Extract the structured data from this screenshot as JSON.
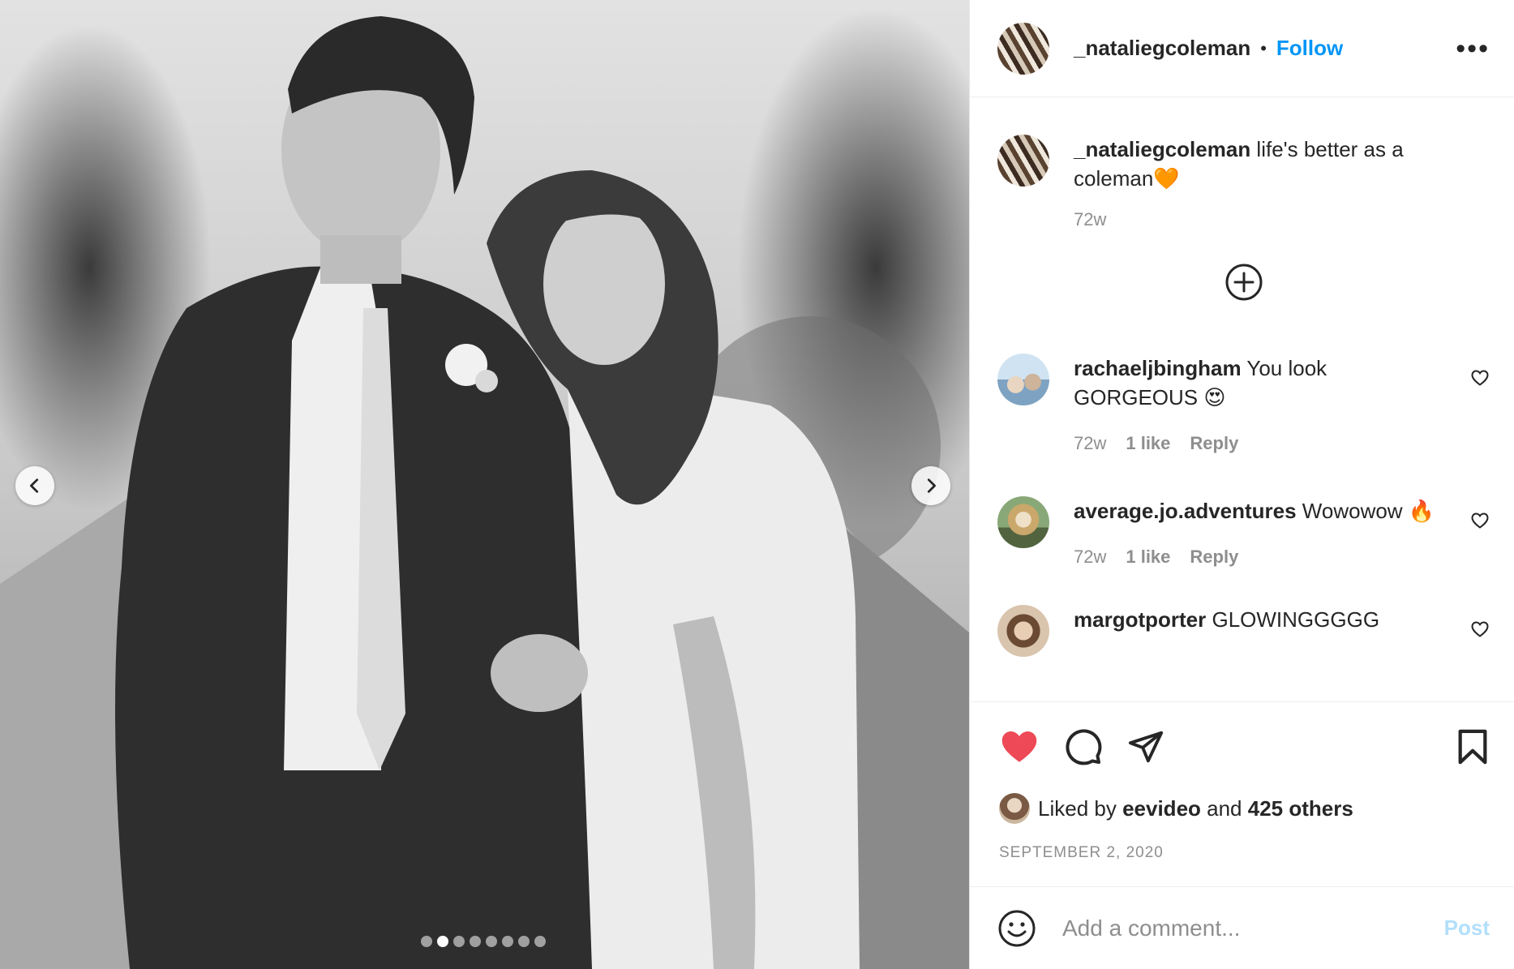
{
  "post": {
    "author": "_nataliegcoleman",
    "separator": "•",
    "follow_label": "Follow",
    "more_label": "•••",
    "carousel": {
      "total": 8,
      "active_index": 1
    }
  },
  "caption": {
    "username": "_nataliegcoleman",
    "text": " life's better as a coleman🧡",
    "age": "72w"
  },
  "comments": [
    {
      "username": "rachaeljbingham",
      "text": " You look GORGEOUS 😍",
      "age": "72w",
      "likes": "1 like",
      "reply": "Reply"
    },
    {
      "username": "average.jo.adventures",
      "text": " Wowowow 🔥",
      "age": "72w",
      "likes": "1 like",
      "reply": "Reply"
    },
    {
      "username": "margotporter",
      "text": " GLOWINGGGGG"
    }
  ],
  "likes": {
    "prefix": "Liked by ",
    "user": "eevideo",
    "middle": " and ",
    "others": "425 others"
  },
  "date": "SEPTEMBER 2, 2020",
  "add_comment": {
    "placeholder": "Add a comment...",
    "post_label": "Post"
  },
  "colors": {
    "follow": "#0095f6",
    "like_heart": "#ed4956",
    "post_disabled": "#b2dffc"
  },
  "icons": [
    "chevron-left-icon",
    "chevron-right-icon",
    "more-icon",
    "plus-circle-icon",
    "heart-icon",
    "comment-icon",
    "share-icon",
    "bookmark-icon",
    "emoji-icon"
  ]
}
